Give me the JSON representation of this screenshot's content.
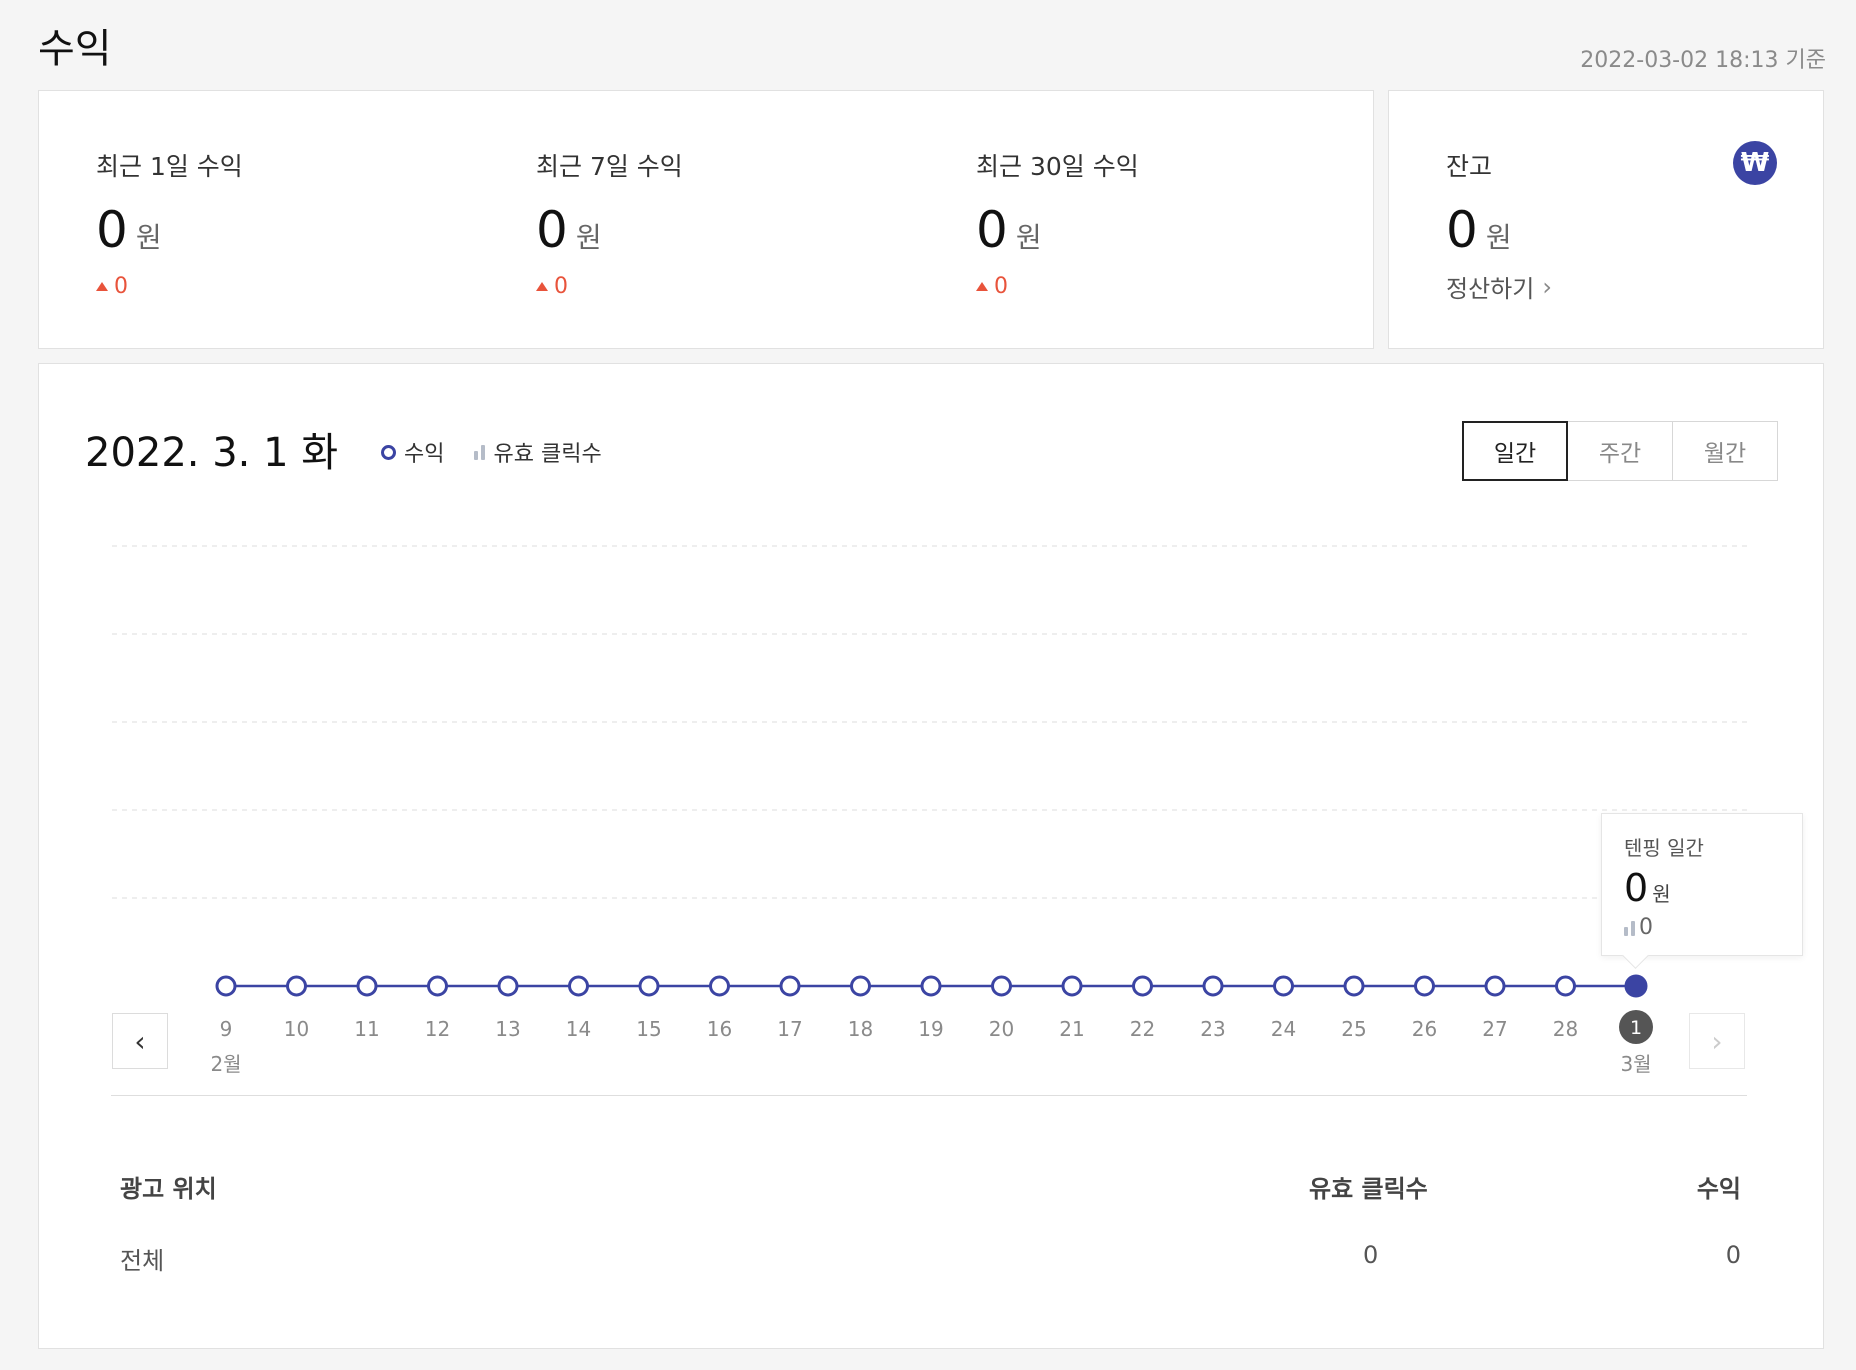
{
  "header": {
    "title": "수익",
    "as_of": "2022-03-02 18:13 기준"
  },
  "summary": {
    "stats": [
      {
        "label": "최근 1일 수익",
        "value": "0",
        "unit": "원",
        "change": "0"
      },
      {
        "label": "최근 7일 수익",
        "value": "0",
        "unit": "원",
        "change": "0"
      },
      {
        "label": "최근 30일 수익",
        "value": "0",
        "unit": "원",
        "change": "0"
      }
    ]
  },
  "balance": {
    "label": "잔고",
    "value": "0",
    "unit": "원",
    "currency_symbol": "₩",
    "settle_label": "정산하기"
  },
  "chart_panel": {
    "date": "2022. 3. 1 화",
    "legend": {
      "revenue": "수익",
      "clicks": "유효 클릭수"
    },
    "tabs": [
      {
        "label": "일간",
        "active": true
      },
      {
        "label": "주간",
        "active": false
      },
      {
        "label": "월간",
        "active": false
      }
    ],
    "tooltip": {
      "title": "텐핑 일간",
      "value": "0",
      "unit": "원",
      "clicks": "0"
    }
  },
  "chart_data": {
    "type": "line",
    "categories": [
      "9",
      "10",
      "11",
      "12",
      "13",
      "14",
      "15",
      "16",
      "17",
      "18",
      "19",
      "20",
      "21",
      "22",
      "23",
      "24",
      "25",
      "26",
      "27",
      "28",
      "1"
    ],
    "month_labels": [
      {
        "label": "2월",
        "at": "9"
      },
      {
        "label": "3월",
        "at": "1"
      }
    ],
    "selected": "1",
    "series": [
      {
        "name": "수익",
        "values": [
          0,
          0,
          0,
          0,
          0,
          0,
          0,
          0,
          0,
          0,
          0,
          0,
          0,
          0,
          0,
          0,
          0,
          0,
          0,
          0,
          0
        ]
      },
      {
        "name": "유효 클릭수",
        "values": [
          0,
          0,
          0,
          0,
          0,
          0,
          0,
          0,
          0,
          0,
          0,
          0,
          0,
          0,
          0,
          0,
          0,
          0,
          0,
          0,
          0
        ]
      }
    ],
    "grid": true,
    "colors": {
      "line": "#3b44a3",
      "selected_badge": "#555555",
      "axis_text": "#8a8a8a"
    }
  },
  "table": {
    "headers": {
      "position": "광고 위치",
      "clicks": "유효 클릭수",
      "revenue": "수익"
    },
    "rows": [
      {
        "position": "전체",
        "clicks": "0",
        "revenue": "0"
      }
    ]
  }
}
